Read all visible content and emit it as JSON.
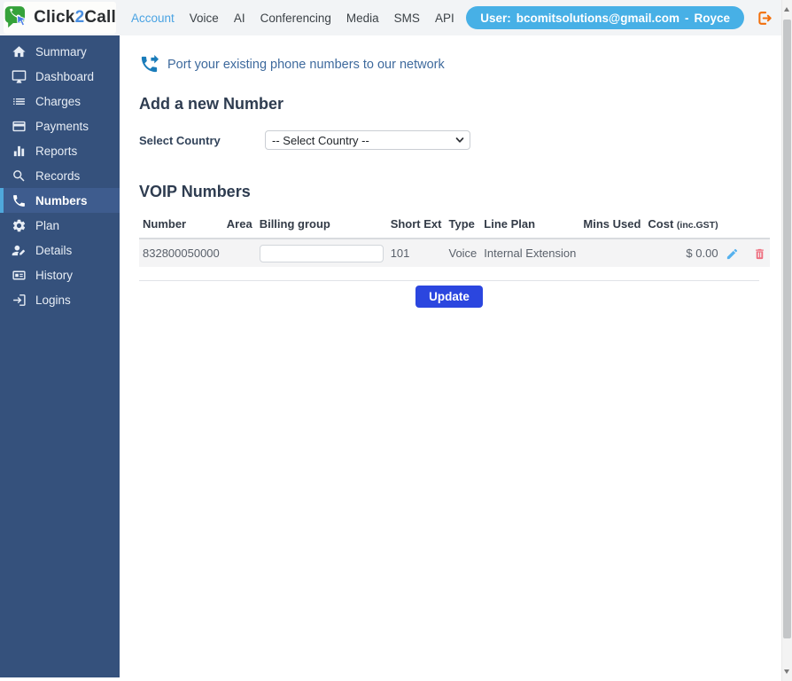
{
  "brand": {
    "prefix": "Click",
    "mid": "2",
    "suffix": "Call"
  },
  "top_nav": {
    "active_item": "Account",
    "items": [
      "Account",
      "Voice",
      "AI",
      "Conferencing",
      "Media",
      "SMS",
      "API"
    ]
  },
  "user_badge": {
    "prefix": "User:",
    "email": "bcomitsolutions@gmail.com",
    "separator": "-",
    "name": "Royce"
  },
  "sidebar": {
    "active_item": "Numbers",
    "items": [
      {
        "label": "Summary",
        "icon": "home-icon"
      },
      {
        "label": "Dashboard",
        "icon": "monitor-icon"
      },
      {
        "label": "Charges",
        "icon": "list-icon"
      },
      {
        "label": "Payments",
        "icon": "credit-card-icon"
      },
      {
        "label": "Reports",
        "icon": "bar-chart-icon"
      },
      {
        "label": "Records",
        "icon": "search-icon"
      },
      {
        "label": "Numbers",
        "icon": "phone-icon"
      },
      {
        "label": "Plan",
        "icon": "gear-icon"
      },
      {
        "label": "Details",
        "icon": "user-edit-icon"
      },
      {
        "label": "History",
        "icon": "card-icon"
      },
      {
        "label": "Logins",
        "icon": "login-arrow-icon"
      }
    ]
  },
  "main": {
    "port_link_text": "Port your existing phone numbers to our network",
    "add_number_heading": "Add a new Number",
    "select_country": {
      "label": "Select Country",
      "selected_option": "-- Select Country --"
    },
    "voip_heading": "VOIP Numbers",
    "table": {
      "headers": [
        "Number",
        "Area",
        "Billing group",
        "Short Ext",
        "Type",
        "Line Plan",
        "Mins Used",
        "Cost"
      ],
      "cost_header_suffix": "(inc.GST)",
      "rows": [
        {
          "number": "832800050000",
          "area": "",
          "billing_group_value": "",
          "short_ext": "101",
          "type": "Voice",
          "line_plan": "Internal Extension",
          "mins_used": "",
          "cost": "$ 0.00"
        }
      ]
    },
    "update_button_label": "Update"
  },
  "colors": {
    "header_bg": "#F2F4F6",
    "sidebar_bg": "#35517C",
    "sidebar_active_bg": "#3E5C8E",
    "sidebar_active_border": "#4FA8DC",
    "nav_active": "#4AA3E3",
    "user_badge_bg": "#47B0E6",
    "logout_orange": "#F2700C",
    "link_blue": "#3E6A9D",
    "port_icon_blue": "#1A7CBA",
    "update_button_bg": "#2B46DF",
    "edit_icon_blue": "#55B1EE",
    "delete_icon_red": "#EE6E7F",
    "brand_green": "#35A23A",
    "brand_blue": "#4A8FE0"
  }
}
